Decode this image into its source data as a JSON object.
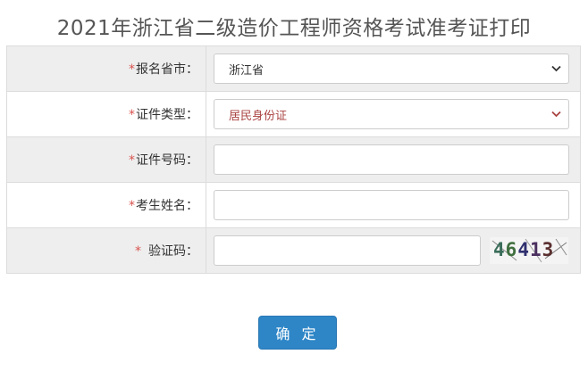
{
  "title": "2021年浙江省二级造价工程师资格考试准考证打印",
  "form": {
    "required_mark": "*",
    "province": {
      "label": "报名省市：",
      "value": "浙江省"
    },
    "id_type": {
      "label": "证件类型：",
      "value": "居民身份证"
    },
    "id_number": {
      "label": "证件号码：",
      "value": ""
    },
    "name": {
      "label": "考生姓名：",
      "value": ""
    },
    "captcha": {
      "label": "验证码：",
      "value": "",
      "image_text": [
        "4",
        "6",
        "4",
        "1",
        "3"
      ]
    }
  },
  "submit_label": "确 定",
  "icons": {
    "select_arrow": "chevron-down-icon"
  },
  "colors": {
    "required": "#d9534f",
    "button": "#2e86c7",
    "row_shade": "#eeeeee"
  }
}
